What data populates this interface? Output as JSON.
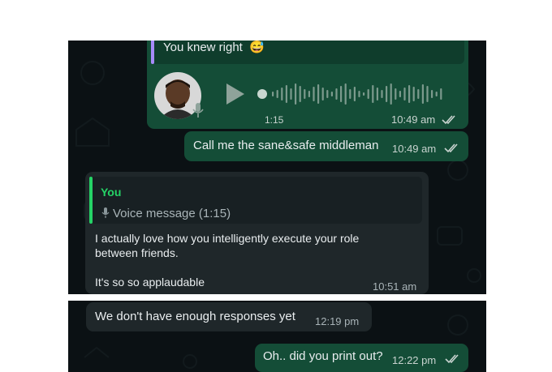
{
  "chat": {
    "quoted_text": "You knew right",
    "quoted_emoji": "😅",
    "voice_note": {
      "duration": "1:15",
      "time": "10:49 am",
      "read_status": "read"
    },
    "messages": [
      {
        "direction": "outgoing",
        "text": "Call me the sane&safe middleman",
        "time": "10:49 am",
        "read_status": "read"
      },
      {
        "direction": "incoming",
        "reply_to": {
          "author": "You",
          "preview": "Voice message (1:15)"
        },
        "lines": [
          "I actually love how you intelligently execute your role",
          "between friends.",
          "It's so so applaudable"
        ],
        "time": "10:51 am"
      },
      {
        "direction": "incoming",
        "text": "We don't have enough responses yet",
        "time": "12:19 pm"
      },
      {
        "direction": "outgoing",
        "text": "Oh.. did you print out?",
        "time": "12:22 pm",
        "read_status": "read"
      }
    ]
  },
  "colors": {
    "chat_background": "#0b1114",
    "outgoing_bubble": "#144d37",
    "incoming_bubble": "#1f272a",
    "accent_green": "#25d366",
    "quote_bar_purple": "#a78bfa",
    "read_ticks": "#c8d3cf"
  }
}
